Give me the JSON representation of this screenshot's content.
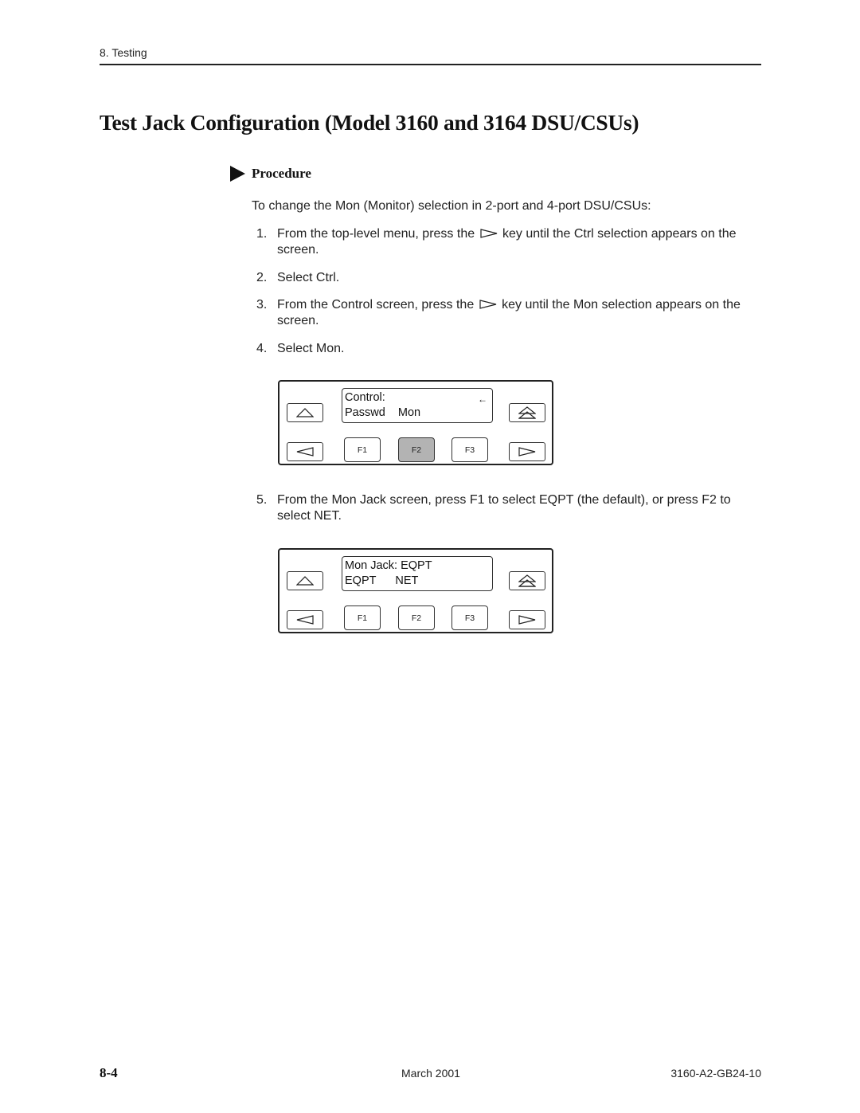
{
  "header": {
    "section": "8. Testing"
  },
  "title": "Test Jack Configuration (Model 3160 and 3164 DSU/CSUs)",
  "procedure": {
    "heading": "Procedure",
    "intro": "To change the Mon (Monitor) selection in 2-port and 4-port DSU/CSUs:",
    "steps": [
      {
        "num": "1.",
        "before": "From the top-level menu, press the",
        "icon": "right-arrow-key-icon",
        "after": "key until the Ctrl selection appears on the screen."
      },
      {
        "num": "2.",
        "text": "Select Ctrl."
      },
      {
        "num": "3.",
        "before": "From the Control screen, press the",
        "icon": "right-arrow-key-icon",
        "after": "key until the Mon selection appears on the screen."
      },
      {
        "num": "4.",
        "text": "Select Mon."
      },
      {
        "num": "5.",
        "text": "From the Mon Jack screen, press F1 to select EQPT (the default), or press F2 to select NET."
      }
    ]
  },
  "panels": [
    {
      "lcd_line1": "Control:",
      "lcd_line2": "Passwd    Mon",
      "lcd_indicator": "←",
      "f_keys": [
        "F1",
        "F2",
        "F3"
      ],
      "pressed_key": "F2"
    },
    {
      "lcd_line1": "Mon Jack: EQPT",
      "lcd_line2": "EQPT      NET",
      "f_keys": [
        "F1",
        "F2",
        "F3"
      ],
      "pressed_key": ""
    }
  ],
  "footer": {
    "page_number": "8-4",
    "date": "March 2001",
    "doc_number": "3160-A2-GB24-10"
  }
}
